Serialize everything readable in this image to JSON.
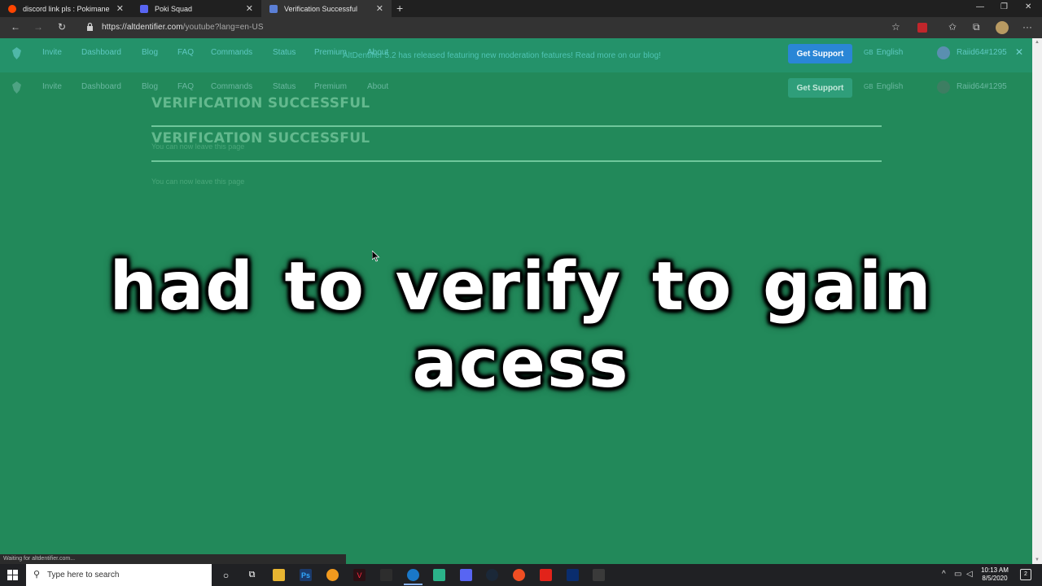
{
  "browser": {
    "tabs": [
      {
        "title": "discord link pls : Pokimane",
        "active": false,
        "favicon": "reddit-icon",
        "color": "#ff4500"
      },
      {
        "title": "Poki Squad",
        "active": false,
        "favicon": "discord-icon",
        "color": "#5865f2"
      },
      {
        "title": "Verification Successful",
        "active": true,
        "favicon": "altdentifier-icon",
        "color": "#5b7fd6"
      }
    ],
    "url_host": "https://altdentifier.com",
    "url_path": "/youtube?lang=en-US",
    "status_text": "Waiting for altdentifier.com..."
  },
  "site": {
    "banner": "AltDentifier 5.2 has released featuring new moderation features! Read more on our blog!",
    "nav": {
      "items": [
        "Invite",
        "Dashboard",
        "Blog",
        "FAQ",
        "Commands",
        "Status",
        "Premium",
        "About"
      ],
      "support_label": "Get Support",
      "lang_flag": "GB",
      "lang_label": "English",
      "username": "Raiid64#1295"
    },
    "heading": "VERIFICATION SUCCESSFUL",
    "subtext": "You can now leave this page"
  },
  "overlay_caption": "had to verify to gain acess",
  "taskbar": {
    "search_placeholder": "Type here to search",
    "time": "10:13 AM",
    "date": "8/5/2020",
    "notification_count": "2"
  },
  "colors": {
    "page_bg": "#22895a",
    "support_button": "#2a86d6"
  }
}
